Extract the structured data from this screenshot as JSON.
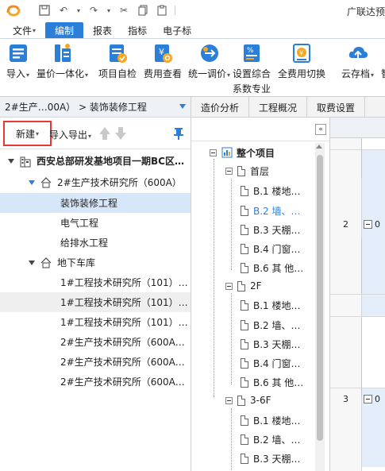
{
  "title": "广联达预",
  "menu": [
    "文件",
    "编制",
    "报表",
    "指标",
    "电子标"
  ],
  "menu_arrow": "▾",
  "ribbon": {
    "import": "导入",
    "qty_bill": "量价一体化",
    "self_check": "项目自检",
    "fee_view": "费用查看",
    "unify_price": "统一调价",
    "set_coef_1": "设置综合",
    "set_coef_2": "系数专业",
    "all_fee_switch": "全费用切换",
    "cloud_save": "云存档",
    "smart": "智"
  },
  "breadcrumb": {
    "path": "2#生产…00A）  >  装饰装修工程"
  },
  "toolbar": {
    "new": "新建",
    "io": "导入导出"
  },
  "project_tree": [
    {
      "label": "西安总部研发基地项目一期BC区…"
    },
    {
      "label": "2#生产技术研究所（600A）"
    },
    {
      "label": "装饰装修工程"
    },
    {
      "label": "电气工程"
    },
    {
      "label": "给排水工程"
    },
    {
      "label": "地下车库"
    },
    {
      "label": "1#工程技术研究所（101）…"
    },
    {
      "label": "1#工程技术研究所（101）…"
    },
    {
      "label": "1#工程技术研究所（101）…"
    },
    {
      "label": "2#生产技术研究所（600A…"
    },
    {
      "label": "2#生产技术研究所（600A…"
    },
    {
      "label": "2#生产技术研究所（600A…"
    }
  ],
  "tabs": [
    "造价分析",
    "工程概况",
    "取费设置"
  ],
  "collapse_glyph": "«",
  "section_tree": {
    "root": "整个项目",
    "groups": [
      {
        "label": "首层",
        "items": [
          "B.1 楼地…",
          "B.2 墙、…",
          "B.3 天棚…",
          "B.4 门窗…",
          "B.6 其 他…"
        ]
      },
      {
        "label": "2F",
        "items": [
          "B.1 楼地…",
          "B.2 墙、…",
          "B.3 天棚…",
          "B.4 门窗…",
          "B.6 其 他…"
        ]
      },
      {
        "label": "3-6F",
        "items": [
          "B.1 楼地…",
          "B.2 墙、…",
          "B.3 天棚…"
        ]
      }
    ]
  },
  "grid": {
    "rows": [
      {
        "num": "2",
        "code": "0"
      },
      {
        "num": "3",
        "code": "0"
      }
    ]
  },
  "colors": {
    "accent": "#2b7fd9",
    "highlight_border": "#e53935",
    "selected_bg": "#d7e7fa"
  }
}
